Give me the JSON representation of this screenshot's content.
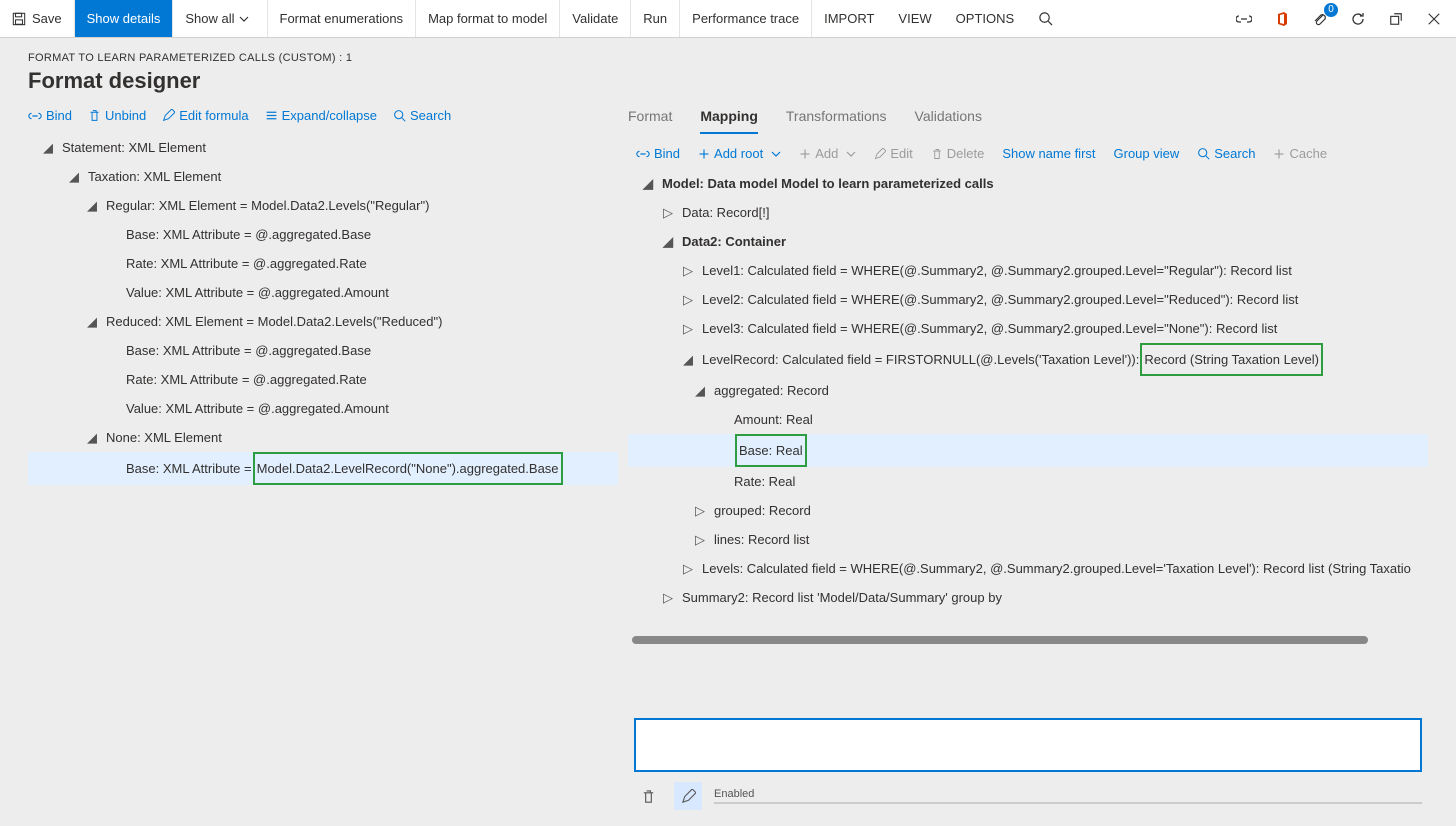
{
  "ribbon": {
    "save": "Save",
    "show_details": "Show details",
    "show_all": "Show all",
    "format_enum": "Format enumerations",
    "map_format": "Map format to model",
    "validate": "Validate",
    "run": "Run",
    "perf_trace": "Performance trace",
    "import": "IMPORT",
    "view": "VIEW",
    "options": "OPTIONS",
    "badge_count": "0"
  },
  "breadcrumb": "FORMAT TO LEARN PARAMETERIZED CALLS (CUSTOM) : 1",
  "page_title": "Format designer",
  "left_actions": {
    "bind": "Bind",
    "unbind": "Unbind",
    "edit_formula": "Edit formula",
    "expand": "Expand/collapse",
    "search": "Search"
  },
  "left_tree": {
    "n0": "Statement: XML Element",
    "n1": "Taxation: XML Element",
    "n2": "Regular: XML Element = Model.Data2.Levels(\"Regular\")",
    "n3": "Base: XML Attribute = @.aggregated.Base",
    "n4": "Rate: XML Attribute = @.aggregated.Rate",
    "n5": "Value: XML Attribute = @.aggregated.Amount",
    "n6": "Reduced: XML Element = Model.Data2.Levels(\"Reduced\")",
    "n7": "Base: XML Attribute = @.aggregated.Base",
    "n8": "Rate: XML Attribute = @.aggregated.Rate",
    "n9": "Value: XML Attribute = @.aggregated.Amount",
    "n10": "None: XML Element",
    "n11a": "Base: XML Attribute = ",
    "n11b": "Model.Data2.LevelRecord(\"None\").aggregated.Base"
  },
  "tabs": {
    "format": "Format",
    "mapping": "Mapping",
    "transformations": "Transformations",
    "validations": "Validations"
  },
  "right_actions": {
    "bind": "Bind",
    "add_root": "Add root",
    "add": "Add",
    "edit": "Edit",
    "delete": "Delete",
    "show_name": "Show name first",
    "group_view": "Group view",
    "search": "Search",
    "cache": "Cache"
  },
  "right_tree": {
    "m0": "Model: Data model Model to learn parameterized calls",
    "m1": "Data: Record[!]",
    "m2": "Data2: Container",
    "m3": "Level1: Calculated field = WHERE(@.Summary2, @.Summary2.grouped.Level=\"Regular\"): Record list",
    "m4": "Level2: Calculated field = WHERE(@.Summary2, @.Summary2.grouped.Level=\"Reduced\"): Record list",
    "m5": "Level3: Calculated field = WHERE(@.Summary2, @.Summary2.grouped.Level=\"None\"): Record list",
    "m6a": "LevelRecord: Calculated field = FIRSTORNULL(@.Levels('Taxation Level')): ",
    "m6b": "Record (String Taxation Level)",
    "m7": "aggregated: Record",
    "m8": "Amount: Real",
    "m9": "Base: Real",
    "m10": "Rate: Real",
    "m11": "grouped: Record",
    "m12": "lines: Record list",
    "m13": "Levels: Calculated field = WHERE(@.Summary2, @.Summary2.grouped.Level='Taxation Level'): Record list (String Taxatio",
    "m14": "Summary2: Record list 'Model/Data/Summary' group by"
  },
  "bottom": {
    "enabled": "Enabled"
  }
}
